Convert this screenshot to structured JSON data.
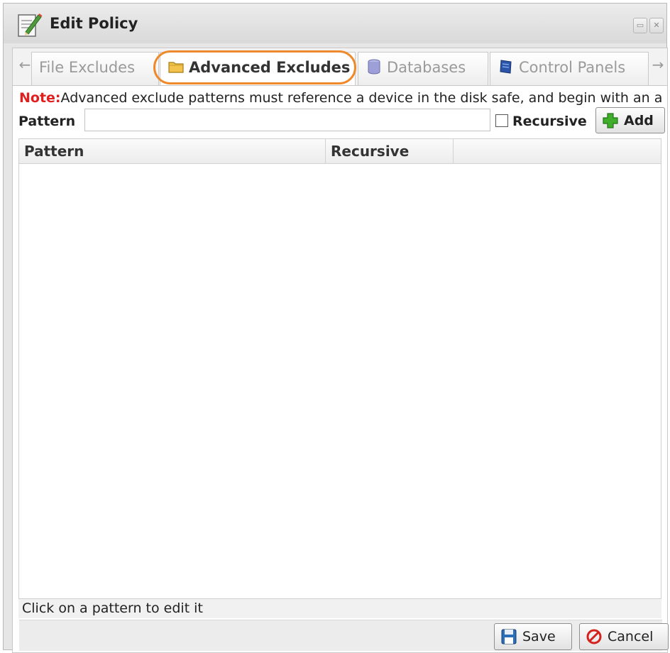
{
  "window": {
    "title": "Edit Policy"
  },
  "tabs": [
    {
      "label": "File Excludes",
      "icon": "none",
      "active": false
    },
    {
      "label": "Advanced Excludes",
      "icon": "folder-icon",
      "active": true
    },
    {
      "label": "Databases",
      "icon": "database-icon",
      "active": false
    },
    {
      "label": "Control Panels",
      "icon": "control-panel-icon",
      "active": false
    }
  ],
  "form": {
    "note_label": "Note:",
    "note_text": "Advanced exclude patterns must reference a device in the disk safe, and begin with an a",
    "pattern_label": "Pattern",
    "pattern_value": "",
    "recursive_label": "Recursive",
    "recursive_checked": false,
    "add_label": "Add"
  },
  "grid": {
    "columns": [
      "Pattern",
      "Recursive"
    ],
    "rows": [],
    "status": "Click on a pattern to edit it"
  },
  "footer": {
    "save_label": "Save",
    "cancel_label": "Cancel"
  },
  "colors": {
    "note_red": "#e0201e",
    "highlight_orange": "#ef8a2c",
    "add_green": "#3fae2a",
    "save_blue": "#2a6fb8",
    "cancel_red": "#d4221c"
  }
}
